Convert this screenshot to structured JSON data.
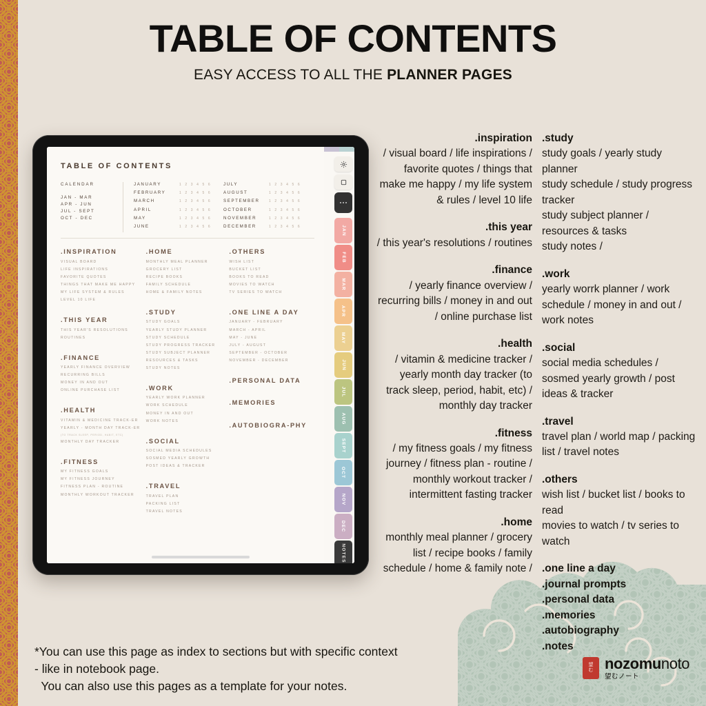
{
  "header": {
    "title": "TABLE OF CONTENTS",
    "subtitle_normal": "EASY ACCESS TO ALL THE ",
    "subtitle_bold": "PLANNER PAGES"
  },
  "tablet": {
    "page_title": "TABLE OF CONTENTS",
    "calendar": {
      "label": "CALENDAR",
      "quarters": [
        "JAN - MAR",
        "APR - JUN",
        "JUL - SEPT",
        "OCT - DEC"
      ],
      "page_numbers": "1 2 3 4 5 6",
      "months_left": [
        "JANUARY",
        "FEBRUARY",
        "MARCH",
        "APRIL",
        "MAY",
        "JUNE"
      ],
      "months_right": [
        "JULY",
        "AUGUST",
        "SEPTEMBER",
        "OCTOBER",
        "NOVEMBER",
        "DECEMBER"
      ]
    },
    "columns": [
      {
        "sections": [
          {
            "heading": ".INSPIRATION",
            "items": [
              "VISUAL BOARD",
              "LIFE INSPIRATIONS",
              "FAVORITE QUOTES",
              "THINGS THAT MAKE ME HAPPY",
              "MY LIFE SYSTEM & RULES",
              "LEVEL 10 LIFE"
            ]
          },
          {
            "heading": ".THIS YEAR",
            "items": [
              "THIS YEAR'S RESOLUTIONS",
              "ROUTINES"
            ]
          },
          {
            "heading": ".FINANCE",
            "items": [
              "YEARLY FINANCE OVERVIEW",
              "RECURRING BILLS",
              "MONEY IN AND OUT",
              "ONLINE PURCHASE LIST"
            ]
          },
          {
            "heading": ".HEALTH",
            "items": [
              "VITAMIN & MEDICINE TRACK-ER",
              "YEARLY - MONTH DAY TRACK-ER",
              "(TO TRACK SLEEP, PERIOD, HABIT, ETC)",
              "MONTHLY DAY TRACKER"
            ]
          },
          {
            "heading": ".FITNESS",
            "items": [
              "MY FITNESS GOALS",
              "MY FITNESS JOURNEY",
              "FITNESS PLAN - ROUTINE",
              "MONTHLY WORKOUT TRACKER"
            ]
          }
        ]
      },
      {
        "sections": [
          {
            "heading": ".HOME",
            "items": [
              "MONTHLY MEAL PLANNER",
              "GROCERY LIST",
              "RECIPE BOOKS",
              "FAMILY SCHEDULE",
              "HOME & FAMILY NOTES"
            ]
          },
          {
            "heading": ".STUDY",
            "items": [
              "STUDY GOALS",
              "YEARLY STUDY PLANNER",
              "STUDY SCHEDULE",
              "STUDY PROGRESS TRACKER",
              "STUDY SUBJECT PLANNER",
              "RESOURCES & TASKS",
              "STUDY NOTES"
            ]
          },
          {
            "heading": ".WORK",
            "items": [
              "YEARLY WORK PLANNER",
              "WORK SCHEDULE",
              "MONEY IN AND OUT",
              "WORK NOTES"
            ]
          },
          {
            "heading": ".SOCIAL",
            "items": [
              "SOCIAL MEDIA SCHEDULES",
              "SOSMED YEARLY GROWTH",
              "POST IDEAS & TRACKER"
            ]
          },
          {
            "heading": ".TRAVEL",
            "items": [
              "TRAVEL PLAN",
              "PACKING LIST",
              "TRAVEL NOTES"
            ]
          }
        ]
      },
      {
        "sections": [
          {
            "heading": ".OTHERS",
            "items": [
              "WISH LIST",
              "BUCKET LIST",
              "BOOKS TO READ",
              "MOVIES TO WATCH",
              "TV SERIES TO WATCH"
            ]
          },
          {
            "heading": ".ONE LINE A DAY",
            "items": [
              "JANUARY - FEBRUARY",
              "MARCH - APRIL",
              "MAY - JUNE",
              "JULY - AUGUST",
              "SEPTEMBER - OCTOBER",
              "NOVEMBER - DECEMBER"
            ]
          },
          {
            "heading": ".PERSONAL DATA",
            "items": []
          },
          {
            "heading": ".MEMORIES",
            "items": []
          },
          {
            "heading": ".AUTOBIOGRA-PHY",
            "items": []
          }
        ]
      }
    ],
    "side_tabs": [
      {
        "label": "JAN",
        "color": "#f2a9a4"
      },
      {
        "label": "FEB",
        "color": "#f08d87"
      },
      {
        "label": "MAR",
        "color": "#f3b1a2"
      },
      {
        "label": "APR",
        "color": "#f5c189"
      },
      {
        "label": "MAY",
        "color": "#ecd091"
      },
      {
        "label": "JUN",
        "color": "#e5cc7e"
      },
      {
        "label": "JUL",
        "color": "#bcc580"
      },
      {
        "label": "AUG",
        "color": "#9dc0b0"
      },
      {
        "label": "SEPT",
        "color": "#a8d2cd"
      },
      {
        "label": "OCT",
        "color": "#9cc7d6"
      },
      {
        "label": "NOV",
        "color": "#b5a6c9"
      },
      {
        "label": "DEC",
        "color": "#cbaec3"
      },
      {
        "label": "NOTES",
        "color": "#3a3a3a"
      }
    ],
    "top_swatches": [
      "#c8c2d4",
      "#b9d2d2"
    ]
  },
  "middle_column": [
    {
      "heading": ".inspiration",
      "body": "/ visual board / life inspirations / favorite quotes / things that make me happy / my life system & rules / level 10 life"
    },
    {
      "heading": ".this year",
      "body": "/ this year's resolutions / routines"
    },
    {
      "heading": ".finance",
      "body": "/ yearly finance overview / recurring bills / money in and out / online purchase list"
    },
    {
      "heading": ".health",
      "body": "/ vitamin & medicine tracker / yearly month day tracker (to track sleep, period, habit, etc) / monthly day tracker"
    },
    {
      "heading": ".fitness",
      "body": "/ my fitness goals / my fitness journey / fitness plan - routine / monthly workout  tracker / intermittent fasting tracker"
    },
    {
      "heading": ".home",
      "body": "monthly meal planner / grocery list / recipe books / family schedule / home & family note /"
    }
  ],
  "right_column": [
    {
      "heading": ".study",
      "body": "study goals / yearly study planner\nstudy schedule / study progress tracker\nstudy subject planner / resources & tasks\nstudy notes /"
    },
    {
      "heading": ".work",
      "body": "yearly worrk planner / work schedule / money in and out / work notes"
    },
    {
      "heading": ".social",
      "body": "social media schedules / sosmed yearly growth / post ideas & tracker"
    },
    {
      "heading": ".travel",
      "body": "travel plan / world map / packing list / travel notes"
    },
    {
      "heading": ".others",
      "body": "wish list / bucket list / books to read\nmovies to watch / tv series to watch"
    }
  ],
  "right_bold_list": [
    ".one line a day",
    ".journal prompts",
    ".personal data",
    ".memories",
    ".autobiography",
    ".notes"
  ],
  "footer": {
    "line1": "*You can use this page as index to sections but with specific context",
    "line2": "- like in notebook page.",
    "line3": "  You can also use this pages as a template for your notes."
  },
  "logo": {
    "name_bold": "nozomu",
    "name_light": "noto",
    "japanese": "望むノート",
    "mark_chars": [
      "望",
      "む"
    ]
  },
  "colors": {
    "background": "#e8e1d8",
    "border_red": "#c05a52",
    "border_gold": "#cf9432",
    "cloud_green": "#a9bcae",
    "text_dark": "#17150f",
    "planner_brown": "#6b5344"
  }
}
